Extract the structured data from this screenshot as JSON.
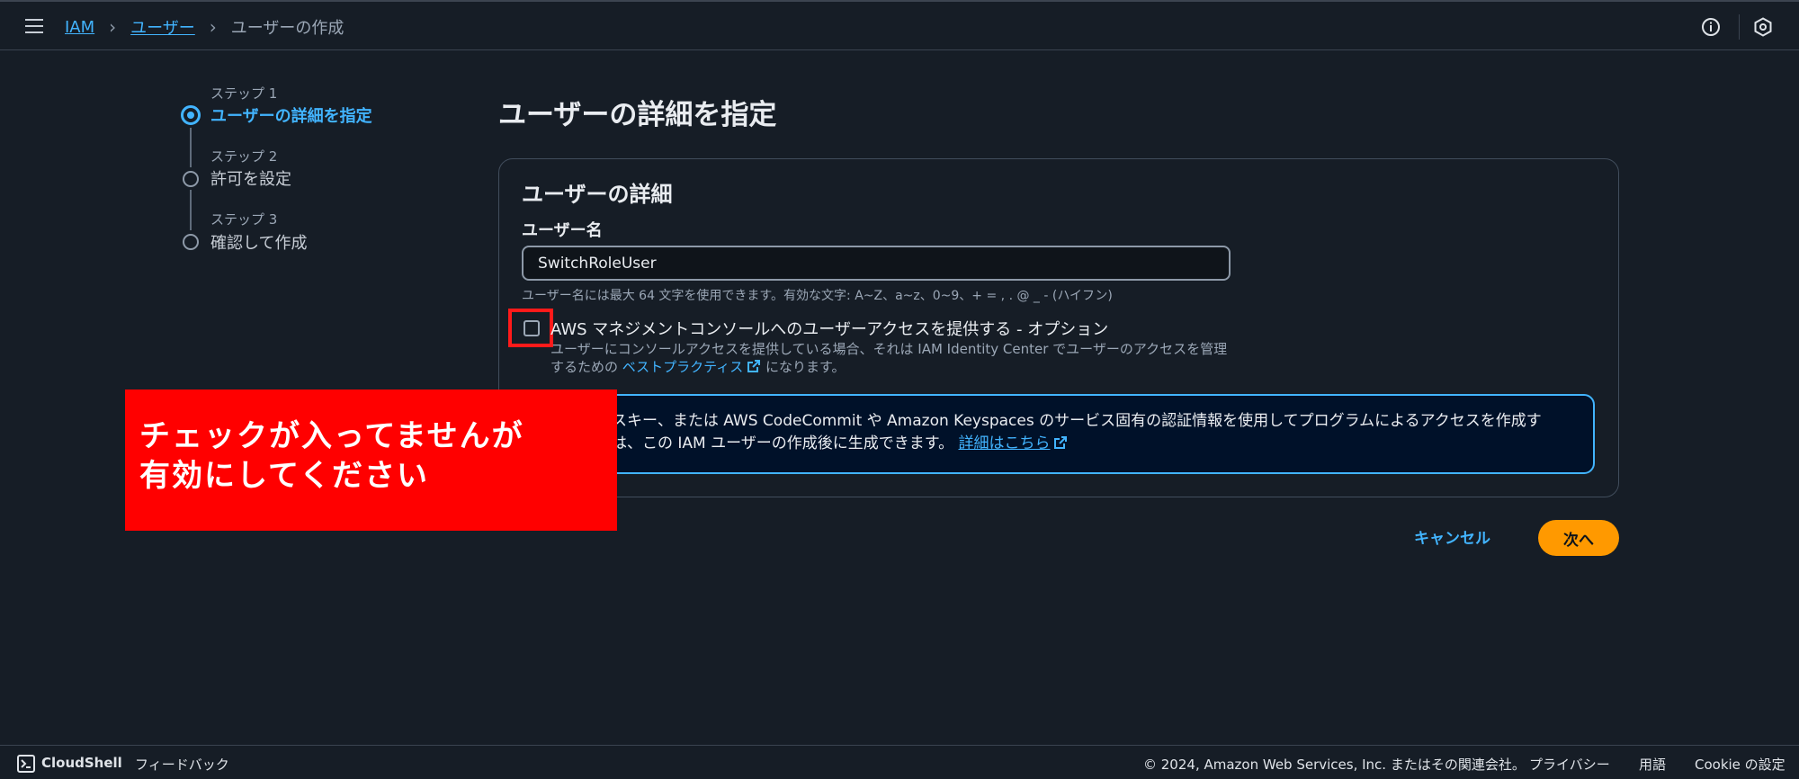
{
  "breadcrumb": {
    "items": [
      "IAM",
      "ユーザー"
    ],
    "current": "ユーザーの作成"
  },
  "steps": [
    {
      "label": "ステップ 1",
      "title": "ユーザーの詳細を指定",
      "active": true
    },
    {
      "label": "ステップ 2",
      "title": "許可を設定",
      "active": false
    },
    {
      "label": "ステップ 3",
      "title": "確認して作成",
      "active": false
    }
  ],
  "main": {
    "page_title": "ユーザーの詳細を指定",
    "section_title": "ユーザーの詳細",
    "username_label": "ユーザー名",
    "username_value": "SwitchRoleUser",
    "username_constraint": "ユーザー名には最大 64 文字を使用できます。有効な文字: A~Z、a~z、0~9、+ = , . @ _ - (ハイフン)",
    "console_access_label": "AWS マネジメントコンソールへのユーザーアクセスを提供する - オプション",
    "console_access_desc_1": "ユーザーにコンソールアクセスを提供している場合、それは IAM Identity Center でユーザーのアクセスを管理するための",
    "console_access_link": "ベストプラクティス",
    "console_access_desc_2": "になります。",
    "info_line1": "スキー、または AWS CodeCommit や Amazon Keyspaces のサービス固有の認証情報を使用してプログラムによるアクセスを作成す",
    "info_line2": "は、この IAM ユーザーの作成後に生成できます。",
    "info_link": "詳細はこちら"
  },
  "annotation": {
    "line1": "チェックが入ってませんが",
    "line2": "有効にしてください"
  },
  "actions": {
    "cancel": "キャンセル",
    "next": "次へ"
  },
  "footer": {
    "cloudshell": "CloudShell",
    "feedback": "フィードバック",
    "copyright": "© 2024, Amazon Web Services, Inc. またはその関連会社。",
    "privacy": "プライバシー",
    "terms": "用語",
    "cookie": "Cookie の設定"
  },
  "colors": {
    "background": "#161d26",
    "link": "#42b4ff",
    "primary_button": "#ff9900",
    "annotation": "#ff0000"
  }
}
